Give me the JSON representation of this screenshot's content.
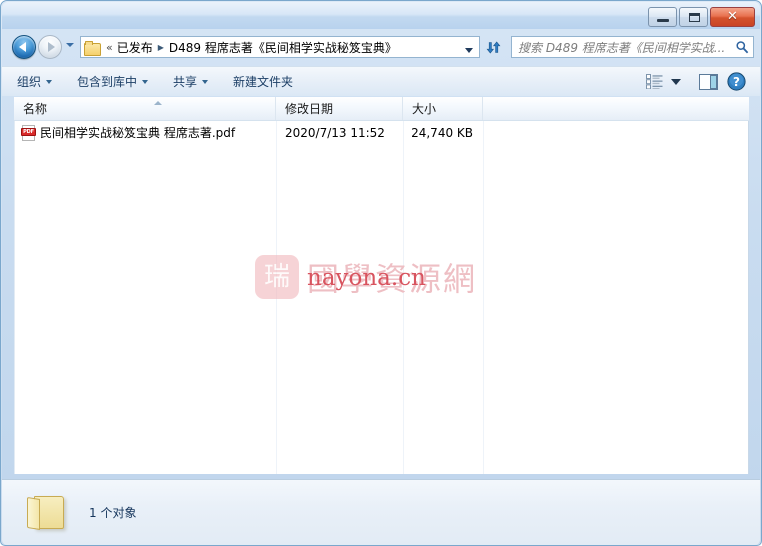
{
  "window": {
    "controls": {
      "minimize_label": "最小化",
      "maximize_label": "最大化",
      "close_label": "✕"
    }
  },
  "navigation": {
    "back_label": "后退",
    "forward_label": "前进",
    "recent_pages_label": "最近浏览的页面",
    "refresh_label": "刷新",
    "address": {
      "folder_icon": "folder-icon",
      "overflow_chevron": "«",
      "separator": "▶",
      "crumbs": [
        {
          "label": "已发布"
        },
        {
          "label": "D489 程席志著《民间相学实战秘笈宝典》"
        }
      ],
      "dropdown_label": "以前的位置"
    }
  },
  "search": {
    "placeholder": "搜索 D489 程席志著《民间相学实战...",
    "value": "",
    "icon": "search-icon"
  },
  "toolbar": {
    "items": [
      {
        "label": "组织",
        "has_caret": true
      },
      {
        "label": "包含到库中",
        "has_caret": true
      },
      {
        "label": "共享",
        "has_caret": true
      },
      {
        "label": "新建文件夹",
        "has_caret": false
      }
    ],
    "views_icon": "list-view-icon",
    "views_caret_label": "更改视图",
    "preview_pane_icon": "preview-pane-icon",
    "help_icon": "help-icon"
  },
  "columns": [
    {
      "key": "name",
      "label": "名称",
      "sorted": "asc"
    },
    {
      "key": "date",
      "label": "修改日期",
      "sorted": ""
    },
    {
      "key": "size",
      "label": "大小",
      "sorted": ""
    },
    {
      "key": "rest",
      "label": "",
      "sorted": ""
    }
  ],
  "files": [
    {
      "icon": "pdf-file-icon",
      "icon_text": "PDF",
      "name": "民间相学实战秘笈宝典 程席志著.pdf",
      "date_modified": "2020/7/13 11:52",
      "size": "24,740 KB"
    }
  ],
  "watermark": {
    "logo_glyph": "瑞",
    "site_name_cn": "國學資源網",
    "site_url": "nayona.cn",
    "logo_color": "#f2b9bd",
    "text_color": "#eebfc4",
    "url_color": "#d8545f"
  },
  "statusbar": {
    "folder_icon": "open-folder-icon",
    "item_count_text": "1 个对象"
  },
  "theme": {
    "accent": "#1c69b0",
    "frame": "#bfd5ec",
    "close_button": "#d4522d",
    "pdf_red": "#d92b2b"
  }
}
